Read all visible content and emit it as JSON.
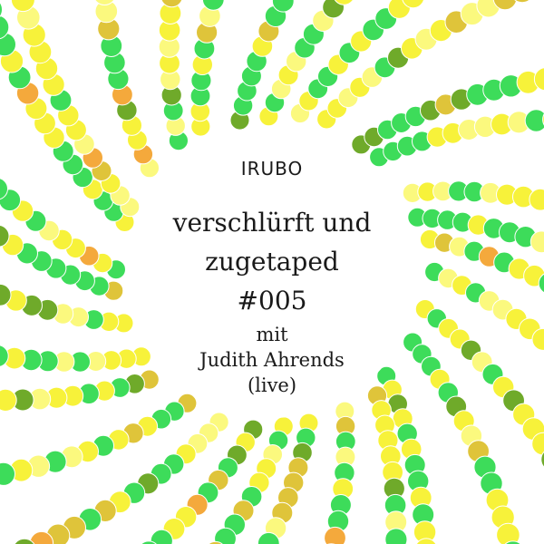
{
  "cover": {
    "label": "IRUBO",
    "title_line1": "verschlürft und",
    "title_line2": "zugetaped",
    "episode": "#005",
    "with": "mit",
    "artist": "Judith Ahrends",
    "note": "(live)"
  },
  "palette": {
    "green": "#3ddc5a",
    "yellow": "#f7f23a",
    "pale_yellow": "#fbf97e",
    "olive": "#6faa2a",
    "mustard": "#dfc43a",
    "orange": "#f4a93c",
    "background": "#ffffff"
  }
}
